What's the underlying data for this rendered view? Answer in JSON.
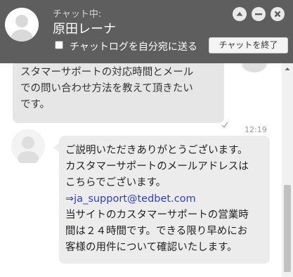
{
  "header": {
    "status": "チャット中:",
    "agent_name": "原田レーナ",
    "transcript_label": "チャットログを自分宛に送る",
    "end_chat_label": "チャットを終了",
    "buttons": [
      "maximize-icon",
      "minimize-icon",
      "close-icon"
    ]
  },
  "messages": [
    {
      "sender": "visitor",
      "text": "スタマーサポートの対応時間とメール\nでの問い合わせ方法を教えて頂きたい\nです。",
      "status_icon": "check-icon"
    },
    {
      "sender": "agent",
      "time": "12:19",
      "lines": [
        "ご説明いただきありがとうございます。",
        "カスタマーサポートのメールアドレスは",
        "こちらでございます。"
      ],
      "email": "⇒ja_support@tedbet.com",
      "lines_after": [
        "当サイトのカスタマーサポートの営業時",
        "間は２４時間です。できる限り早めにお",
        "客様の用件について確認いたします。"
      ]
    }
  ],
  "colors": {
    "header_bg": "#5e5e5e",
    "visitor_bubble": "#e6e6e6",
    "agent_bubble": "#ececec",
    "link": "#2b3fd1"
  }
}
